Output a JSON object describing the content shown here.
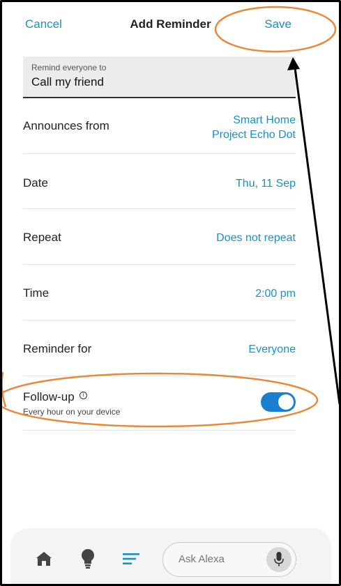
{
  "header": {
    "cancel_label": "Cancel",
    "title": "Add Reminder",
    "save_label": "Save"
  },
  "reminder_field": {
    "label": "Remind everyone to",
    "value": "Call my friend"
  },
  "rows": {
    "announces": {
      "label": "Announces from",
      "value_line1": "Smart Home",
      "value_line2": "Project Echo Dot"
    },
    "date": {
      "label": "Date",
      "value": "Thu, 11 Sep"
    },
    "repeat": {
      "label": "Repeat",
      "value": "Does not repeat"
    },
    "time": {
      "label": "Time",
      "value": "2:00 pm"
    },
    "reminder_for": {
      "label": "Reminder for",
      "value": "Everyone"
    }
  },
  "follow_up": {
    "title": "Follow-up",
    "info_glyph": "i",
    "subtitle": "Every hour on your device",
    "enabled": true
  },
  "bottom_nav": {
    "items": [
      "home-icon",
      "lightbulb-icon",
      "menu-icon"
    ],
    "ask_placeholder": "Ask Alexa",
    "mic_icon": "microphone-icon"
  },
  "colors": {
    "accent": "#1a8fc9",
    "toggle_on": "#1a7fd1",
    "annotation_orange": "#e8883a",
    "field_background": "#ececec"
  }
}
